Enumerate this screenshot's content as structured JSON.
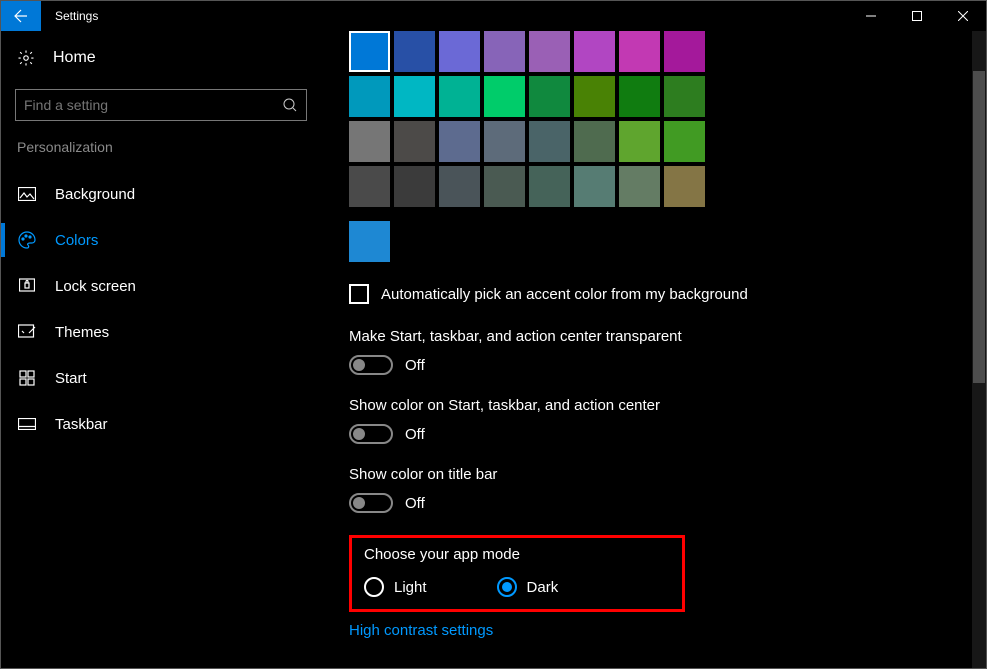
{
  "title": "Settings",
  "home": "Home",
  "search_placeholder": "Find a setting",
  "section": "Personalization",
  "nav": {
    "background": "Background",
    "colors": "Colors",
    "lockscreen": "Lock screen",
    "themes": "Themes",
    "start": "Start",
    "taskbar": "Taskbar"
  },
  "swatch_rows": [
    [
      "#0078d7",
      "#2850a6",
      "#6b69d6",
      "#8764b8",
      "#9a60b5",
      "#b146c2",
      "#c239b3",
      "#a4199b"
    ],
    [
      "#0099bc",
      "#00b7c3",
      "#00b294",
      "#00cc6a",
      "#10893e",
      "#498205",
      "#107c10",
      "#2d7d1f"
    ],
    [
      "#767676",
      "#4c4a48",
      "#5d6b8f",
      "#5d6b7a",
      "#4a6468",
      "#4f6b4f",
      "#5fa52e",
      "#419b23"
    ],
    [
      "#4a4a4a",
      "#3b3b3b",
      "#4a5459",
      "#4a5a52",
      "#456359",
      "#567c73",
      "#647c64",
      "#847545"
    ]
  ],
  "selected_color": "#1e88d3",
  "auto_pick": "Automatically pick an accent color from my background",
  "transparent": {
    "label": "Make Start, taskbar, and action center transparent",
    "state": "Off"
  },
  "show_color_start": {
    "label": "Show color on Start, taskbar, and action center",
    "state": "Off"
  },
  "show_color_title": {
    "label": "Show color on title bar",
    "state": "Off"
  },
  "app_mode": {
    "label": "Choose your app mode",
    "light": "Light",
    "dark": "Dark"
  },
  "high_contrast": "High contrast settings"
}
